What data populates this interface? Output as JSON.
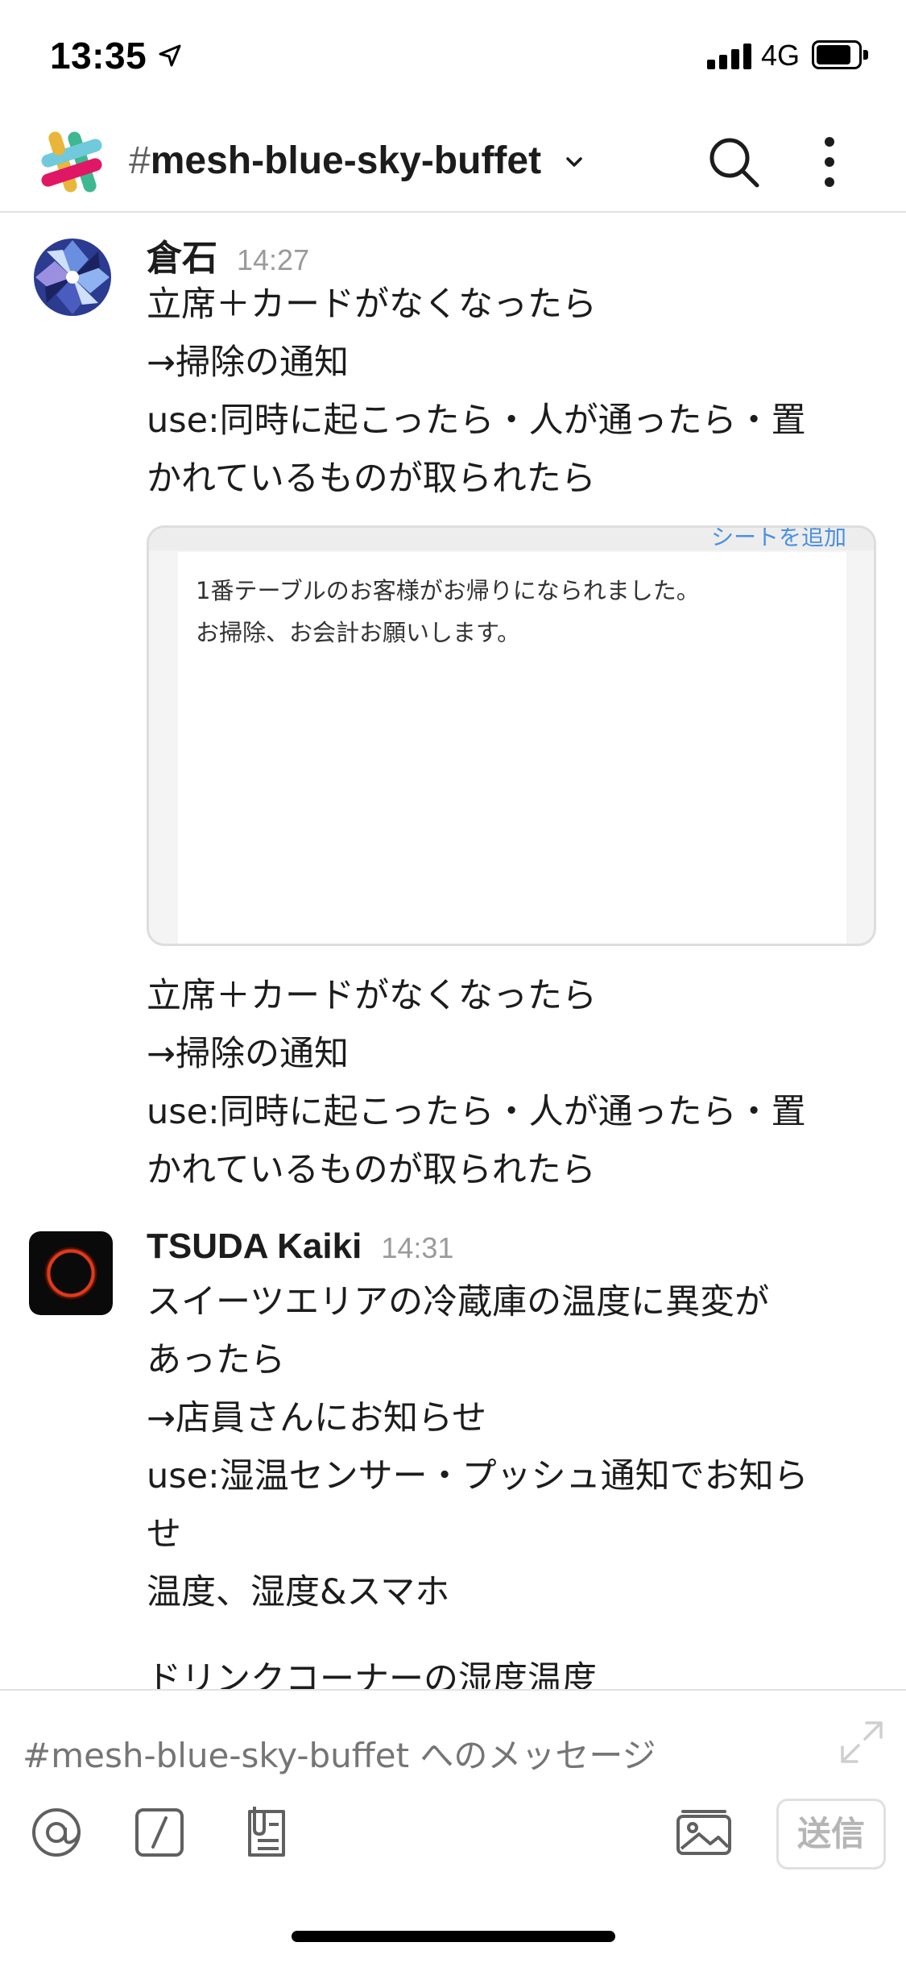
{
  "status_bar": {
    "time": "13:35",
    "network": "4G",
    "icons": [
      "location-arrow-icon",
      "signal-icon",
      "battery-icon"
    ]
  },
  "header": {
    "channel_prefix": "#",
    "channel_name": "mesh-blue-sky-buffet",
    "icons": [
      "slack-logo-icon",
      "chevron-down-icon",
      "search-icon",
      "more-vertical-icon"
    ]
  },
  "messages": [
    {
      "author": "倉石",
      "time": "14:27",
      "lines": [
        "立席＋カードがなくなったら",
        "→掃除の通知",
        "use:同時に起こったら・人が通ったら・置",
        "かれているものが取られたら"
      ],
      "attachment": {
        "header_partial": "シートを追加",
        "lines": [
          "1番テーブルのお客様がお帰りになられました。",
          "お掃除、お会計お願いします。"
        ]
      },
      "lines_after": [
        "立席＋カードがなくなったら",
        "→掃除の通知",
        "use:同時に起こったら・人が通ったら・置",
        "かれているものが取られたら"
      ]
    },
    {
      "author": "TSUDA Kaiki",
      "time": "14:31",
      "lines": [
        "スイーツエリアの冷蔵庫の温度に異変が",
        "あったら",
        "→店員さんにお知らせ",
        "use:湿温センサー・プッシュ通知でお知ら",
        "せ",
        "温度、湿度&スマホ"
      ],
      "partial_line": "ドリンクコーナーの湿度温度"
    }
  ],
  "composer": {
    "placeholder": "#mesh-blue-sky-buffet へのメッセージ",
    "send_label": "送信",
    "icons": [
      "mention-icon",
      "slash-command-icon",
      "attach-file-icon",
      "photo-icon",
      "expand-icon"
    ]
  }
}
